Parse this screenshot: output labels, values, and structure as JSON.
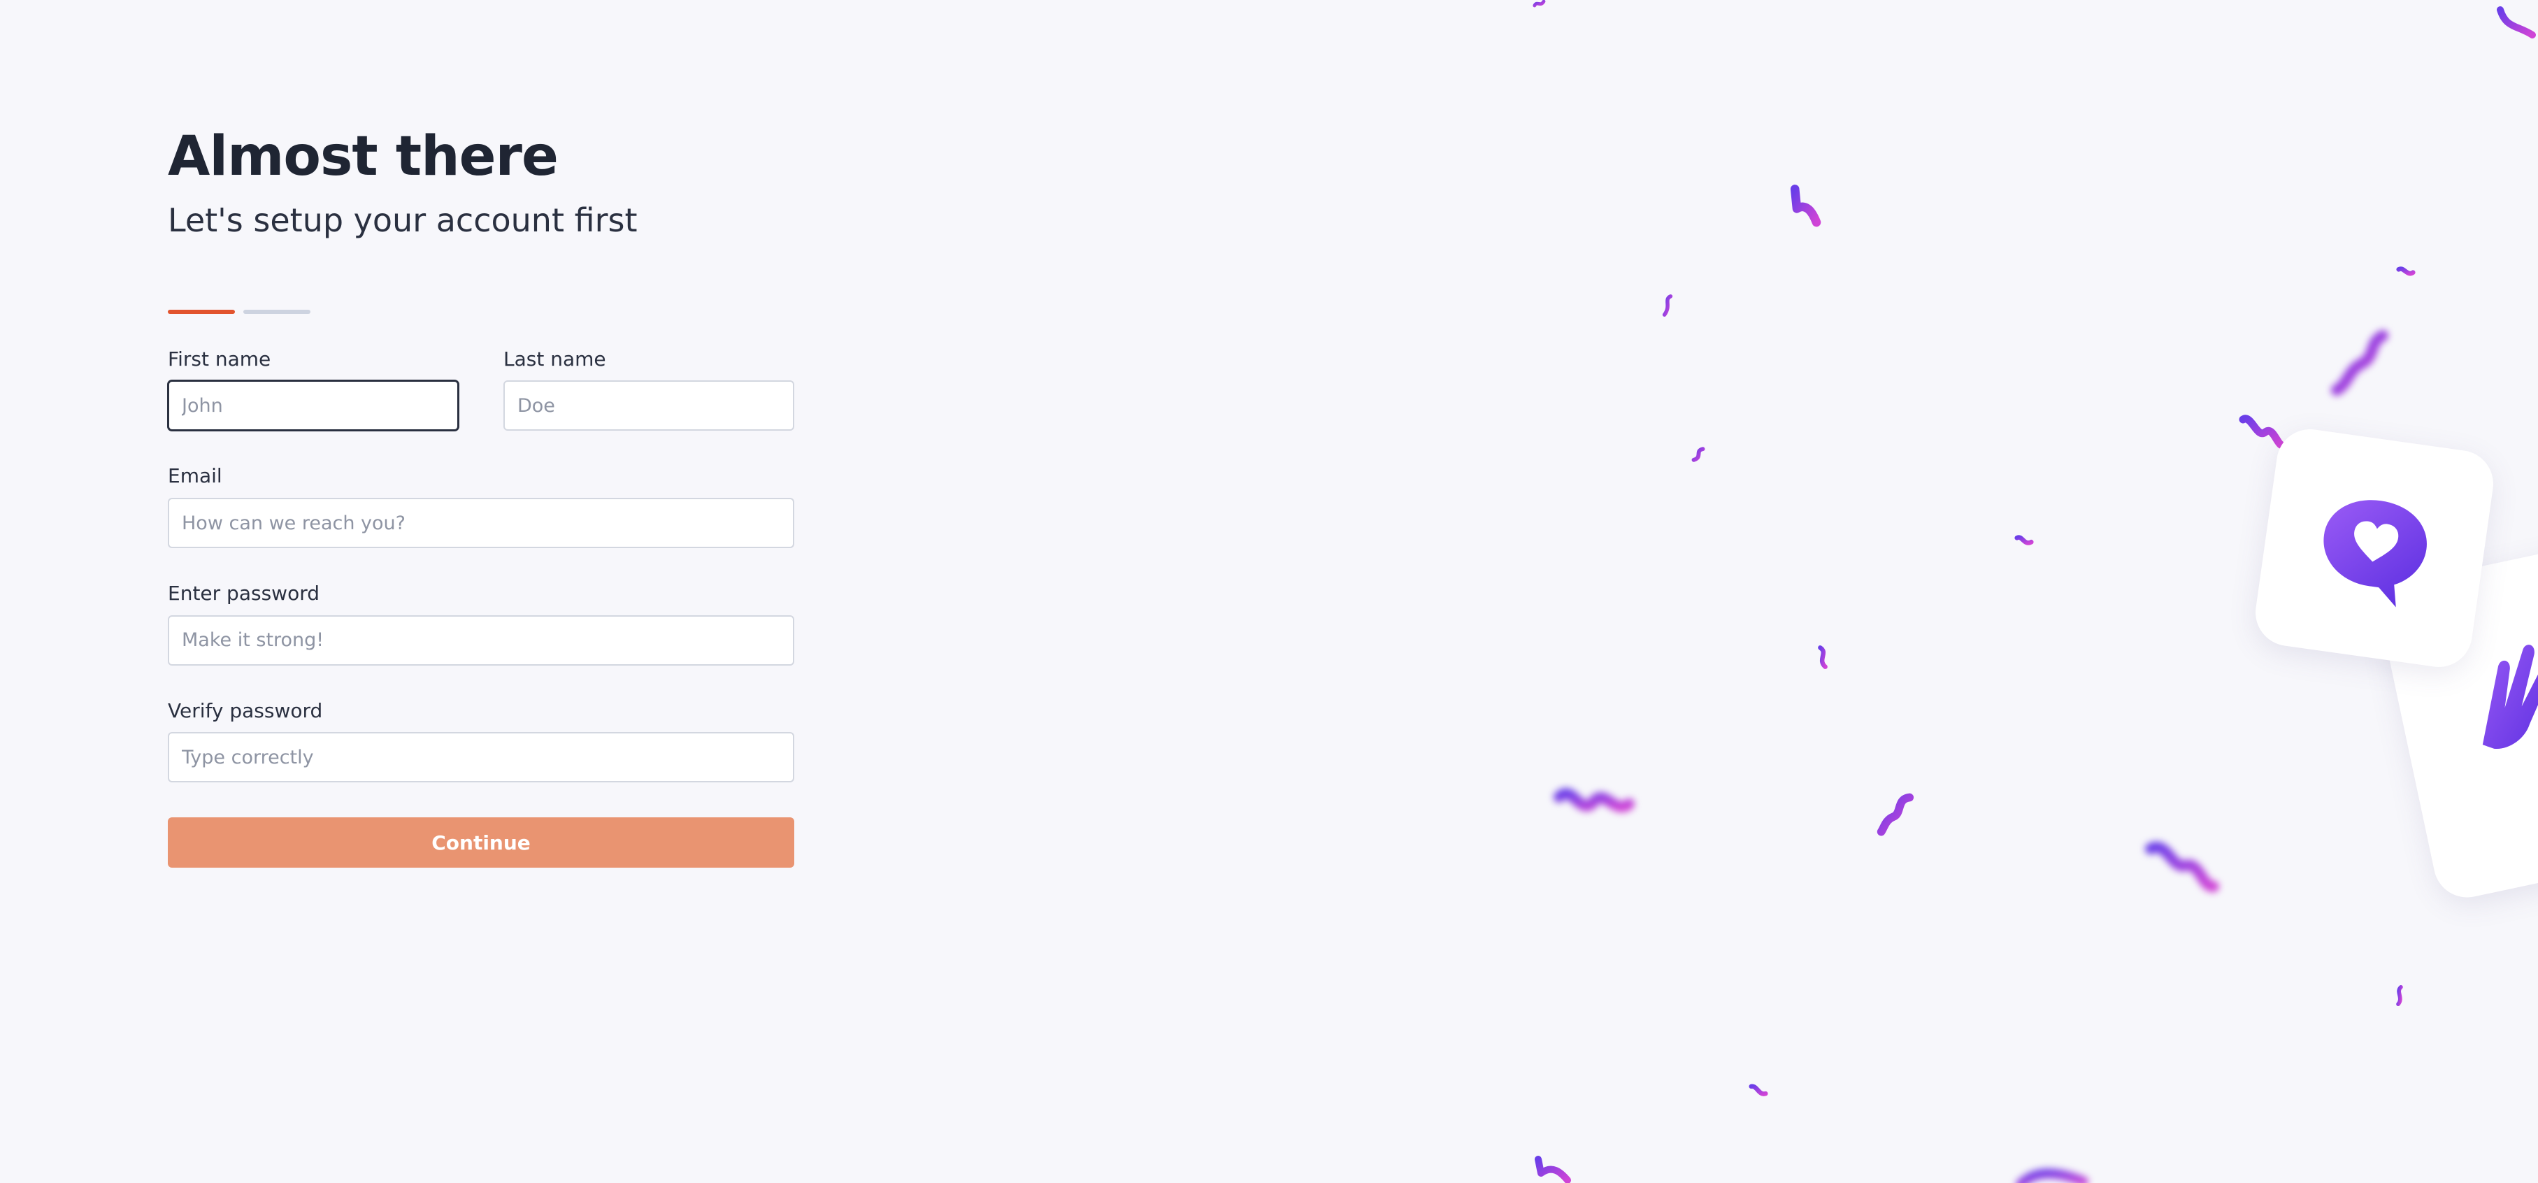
{
  "header": {
    "title": "Almost there",
    "subtitle": "Let's setup your account first"
  },
  "progress": {
    "current_step": 1,
    "total_steps": 2,
    "active_color": "#e2542e",
    "inactive_color": "#cdd3e0"
  },
  "form": {
    "first_name": {
      "label": "First name",
      "placeholder": "John",
      "value": ""
    },
    "last_name": {
      "label": "Last name",
      "placeholder": "Doe",
      "value": ""
    },
    "email": {
      "label": "Email",
      "placeholder": "How can we reach you?",
      "value": ""
    },
    "password": {
      "label": "Enter password",
      "placeholder": "Make it strong!",
      "value": ""
    },
    "verify_password": {
      "label": "Verify password",
      "placeholder": "Type correctly",
      "value": ""
    },
    "continue_label": "Continue"
  },
  "decoration": {
    "icons": [
      "heart-chat-icon",
      "hand-icon"
    ],
    "confetti_colors": [
      "#7b3fe4",
      "#c040d8"
    ]
  }
}
